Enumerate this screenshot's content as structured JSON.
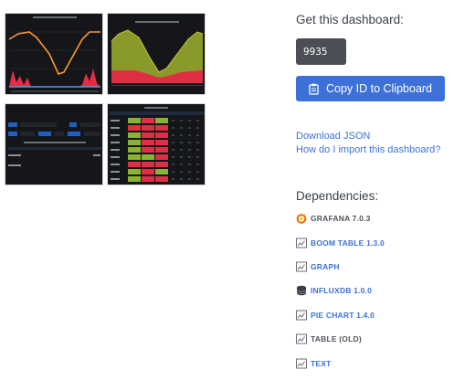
{
  "get_dashboard": {
    "title": "Get this dashboard:",
    "dashboard_id": "9935",
    "copy_button_label": "Copy ID to Clipboard"
  },
  "links": {
    "download_json": "Download JSON",
    "how_to_import": "How do I import this dashboard?"
  },
  "dependencies": {
    "title": "Dependencies:",
    "items": [
      {
        "label": "GRAFANA 7.0.3",
        "icon": "grafana-logo-icon",
        "link": false
      },
      {
        "label": "BOOM TABLE 1.3.0",
        "icon": "panel-icon",
        "link": true
      },
      {
        "label": "GRAPH",
        "icon": "panel-icon",
        "link": true
      },
      {
        "label": "INFLUXDB 1.0.0",
        "icon": "database-icon",
        "link": true
      },
      {
        "label": "PIE CHART 1.4.0",
        "icon": "panel-icon",
        "link": true
      },
      {
        "label": "TABLE (OLD)",
        "icon": "panel-icon",
        "link": false
      },
      {
        "label": "TEXT",
        "icon": "panel-icon",
        "link": true
      }
    ]
  },
  "colors": {
    "accent": "#3d71d9",
    "id_box": "#4b4e54",
    "thumbnail_bg": "#141619"
  },
  "thumbnails": [
    {
      "name": "screenshot-1",
      "style": "line-and-red-bars"
    },
    {
      "name": "screenshot-2",
      "style": "yellow-green-area-over-red"
    },
    {
      "name": "screenshot-3",
      "style": "table-with-filters"
    },
    {
      "name": "screenshot-4",
      "style": "boom-table-heatmap"
    }
  ]
}
